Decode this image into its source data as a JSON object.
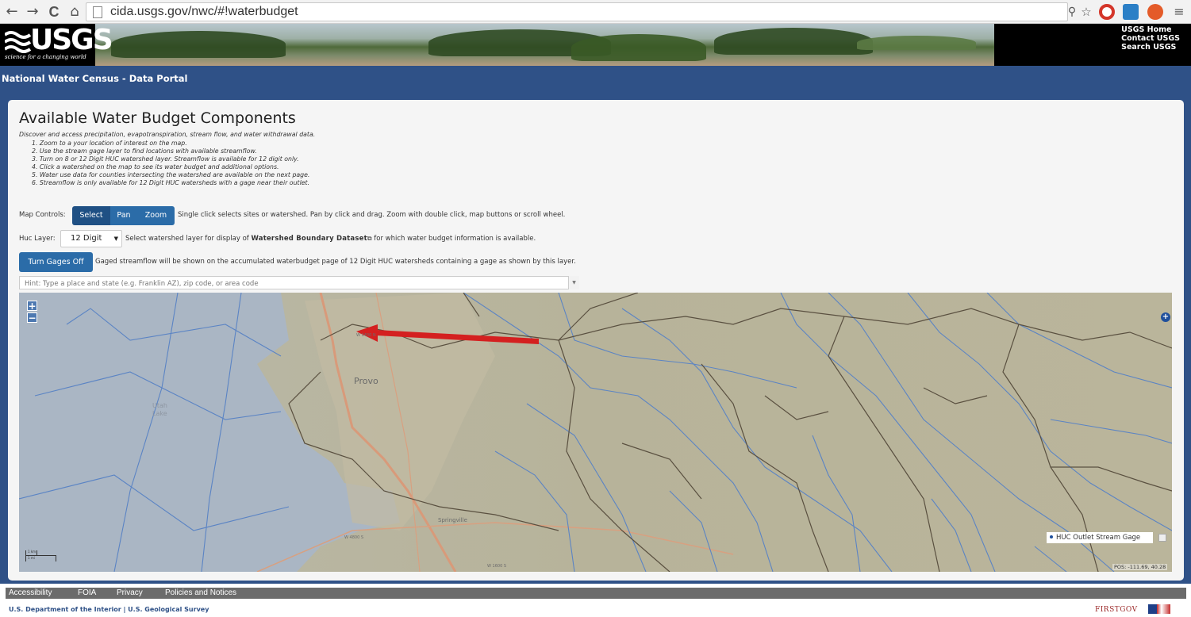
{
  "browser": {
    "url": "cida.usgs.gov/nwc/#!waterbudget",
    "nav": {
      "back": "←",
      "forward": "→",
      "reload": "C",
      "home": "⌂"
    }
  },
  "banner": {
    "logo_text": "USGS",
    "logo_tagline": "science for a changing world",
    "links": [
      "USGS Home",
      "Contact USGS",
      "Search USGS"
    ]
  },
  "titlebar": {
    "title": "National Water Census - Data Portal"
  },
  "main": {
    "heading": "Available Water Budget Components",
    "intro": "Discover and access precipitation, evapotranspiration, stream flow, and water withdrawal data.",
    "steps": [
      "1. Zoom to a your location of interest on the map.",
      "2. Use the stream gage layer to find locations with available streamflow.",
      "3. Turn on 8 or 12 Digit HUC watershed layer. Streamflow is available for 12 digit only.",
      "4. Click a watershed on the map to see its water budget and additional options.",
      "5. Water use data for counties intersecting the watershed are available on the next page.",
      "6. Streamflow is only available for 12 Digit HUC watersheds with a gage near their outlet."
    ],
    "map_controls": {
      "label": "Map Controls:",
      "buttons": [
        "Select",
        "Pan",
        "Zoom"
      ],
      "active": "Select",
      "help": "Single click selects sites or watershed. Pan by click and drag. Zoom with double click, map buttons or scroll wheel."
    },
    "huc_layer": {
      "label": "Huc Layer:",
      "selected": "12 Digit",
      "help_before": "Select watershed layer for display of",
      "help_link": "Watershed Boundary Dataset",
      "help_after": "for which water budget information is available."
    },
    "gages": {
      "button": "Turn Gages Off",
      "help": "Gaged streamflow will be shown on the accumulated waterbudget page of 12 Digit HUC watersheds containing a gage as shown by this layer."
    },
    "search": {
      "placeholder": "Hint: Type a place and state (e.g. Franklin AZ), zip code, or area code"
    }
  },
  "map": {
    "zoom_in": "+",
    "zoom_out": "−",
    "layer_switcher": "+",
    "legend": "HUC Outlet Stream Gage",
    "position": "POS: -111.69, 40.28",
    "labels": {
      "city": "Provo",
      "lake": "Utah Lake",
      "springville": "Springville",
      "street_1": "W 1400 N",
      "street_2": "W 4800 S",
      "street_3": "W 1600 S"
    },
    "scale": {
      "top": "1 km",
      "bottom": "1 mi"
    },
    "colors": {
      "land": "#b7b39a",
      "water": "#aab6c4",
      "rivers": "#5b84c4",
      "boundaries": "#5a5040",
      "annotation_arrow": "#d42020"
    }
  },
  "footer": {
    "links": [
      "Accessibility",
      "FOIA",
      "Privacy",
      "Policies and Notices"
    ],
    "dept": "U.S. Department of the Interior | U.S. Geological Survey",
    "firstgov": "FIRSTGOV"
  }
}
